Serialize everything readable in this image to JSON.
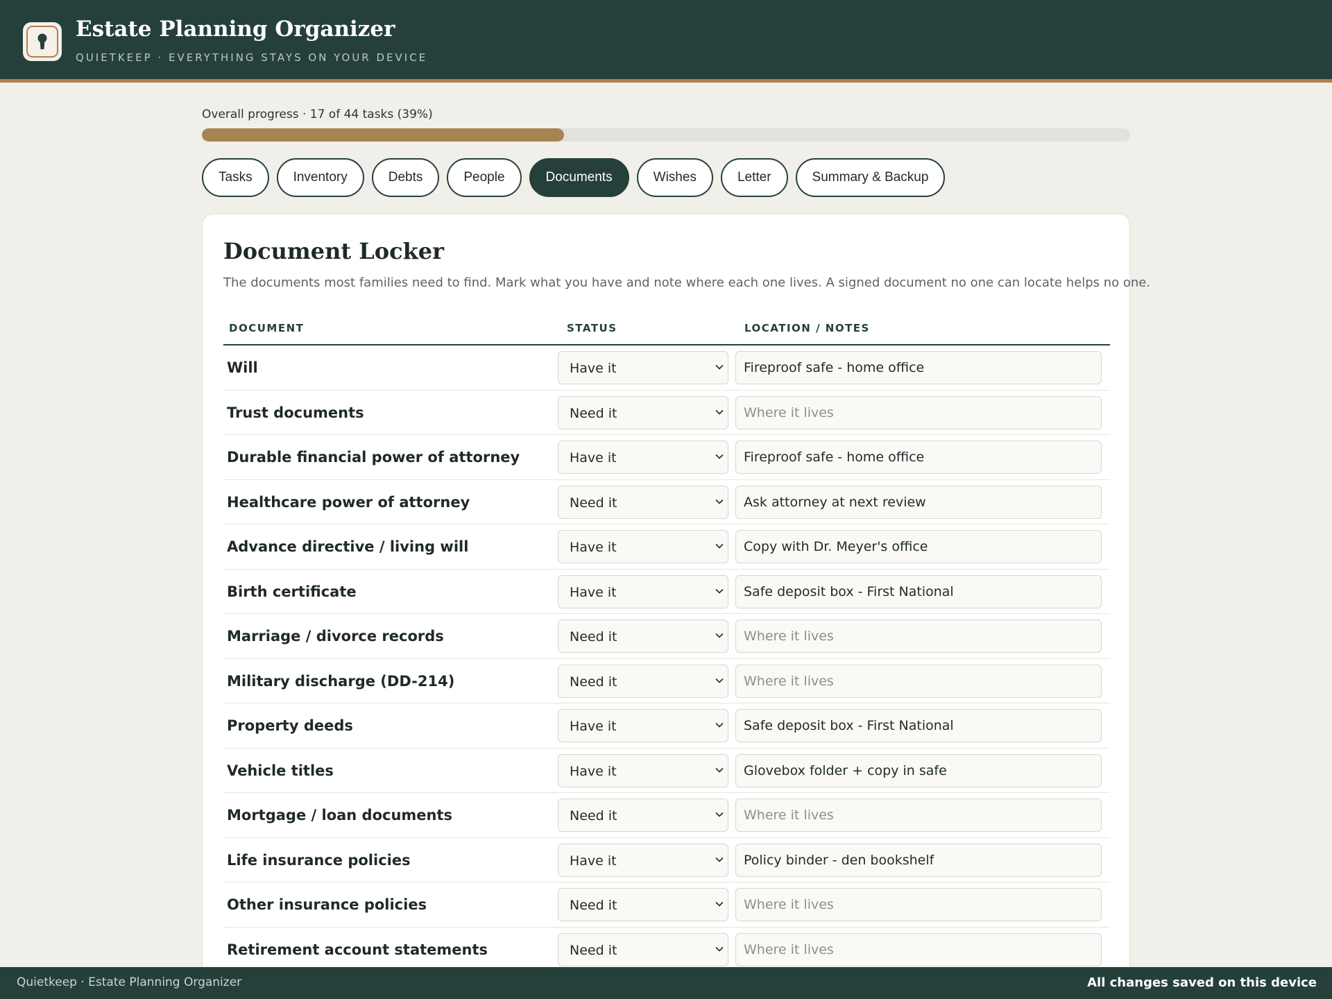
{
  "header": {
    "title": "Estate Planning Organizer",
    "subtitle": "QUIETKEEP · EVERYTHING STAYS ON YOUR DEVICE",
    "logo_icon": "keyhole-icon"
  },
  "progress": {
    "label": "Overall progress · 17 of 44 tasks (39%)",
    "percent": 39
  },
  "tabs": [
    {
      "label": "Tasks",
      "active": false
    },
    {
      "label": "Inventory",
      "active": false
    },
    {
      "label": "Debts",
      "active": false
    },
    {
      "label": "People",
      "active": false
    },
    {
      "label": "Documents",
      "active": true
    },
    {
      "label": "Wishes",
      "active": false
    },
    {
      "label": "Letter",
      "active": false
    },
    {
      "label": "Summary & Backup",
      "active": false
    }
  ],
  "locker": {
    "title": "Document Locker",
    "description": "The documents most families need to find. Mark what you have and note where each one lives. A signed document no one can locate helps no one.",
    "columns": {
      "document": "DOCUMENT",
      "status": "STATUS",
      "location": "LOCATION / NOTES"
    },
    "location_placeholder": "Where it lives",
    "rows": [
      {
        "name": "Will",
        "status": "Have it",
        "location": "Fireproof safe - home office"
      },
      {
        "name": "Trust documents",
        "status": "Need it",
        "location": ""
      },
      {
        "name": "Durable financial power of attorney",
        "status": "Have it",
        "location": "Fireproof safe - home office"
      },
      {
        "name": "Healthcare power of attorney",
        "status": "Need it",
        "location": "Ask attorney at next review"
      },
      {
        "name": "Advance directive / living will",
        "status": "Have it",
        "location": "Copy with Dr. Meyer's office"
      },
      {
        "name": "Birth certificate",
        "status": "Have it",
        "location": "Safe deposit box - First National"
      },
      {
        "name": "Marriage / divorce records",
        "status": "Need it",
        "location": ""
      },
      {
        "name": "Military discharge (DD-214)",
        "status": "Need it",
        "location": ""
      },
      {
        "name": "Property deeds",
        "status": "Have it",
        "location": "Safe deposit box - First National"
      },
      {
        "name": "Vehicle titles",
        "status": "Have it",
        "location": "Glovebox folder + copy in safe"
      },
      {
        "name": "Mortgage / loan documents",
        "status": "Need it",
        "location": ""
      },
      {
        "name": "Life insurance policies",
        "status": "Have it",
        "location": "Policy binder - den bookshelf"
      },
      {
        "name": "Other insurance policies",
        "status": "Need it",
        "location": ""
      },
      {
        "name": "Retirement account statements",
        "status": "Need it",
        "location": ""
      }
    ]
  },
  "footer": {
    "left": "Quietkeep · Estate Planning Organizer",
    "right": "All changes saved on this device"
  },
  "colors": {
    "primary": "#25403b",
    "accent": "#b07d4e",
    "progress": "#a7844f",
    "background": "#f1efea"
  }
}
